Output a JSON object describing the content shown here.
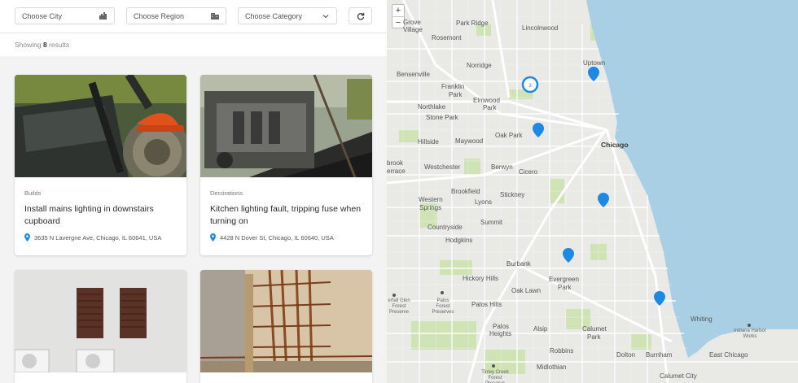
{
  "filters": {
    "city": "Choose City",
    "region": "Choose Region",
    "category": "Choose Category"
  },
  "results": {
    "prefix": "Showing",
    "count": "8",
    "suffix": "results"
  },
  "cards": [
    {
      "category": "Builds",
      "title": "Install mains lighting in downstairs cupboard",
      "address": "3635 N Lavergne Ave, Chicago, IL 60641, USA"
    },
    {
      "category": "Decorations",
      "title": "Kitchen lighting fault, tripping fuse when turning on",
      "address": "4428 N Dover St, Chicago, IL 60640, USA"
    },
    {
      "category": "",
      "title": "",
      "address": ""
    },
    {
      "category": "",
      "title": "",
      "address": ""
    }
  ],
  "map": {
    "zoom_in": "+",
    "zoom_out": "−",
    "cluster_count": "3",
    "labels": [
      "Grove",
      "Village",
      "Park Ridge",
      "Lincolnwood",
      "Rosemont",
      "Norridge",
      "Uptown",
      "Bensenville",
      "Franklin",
      "Park",
      "Elmwood",
      "Park",
      "Northlake",
      "Stone Park",
      "Oak Park",
      "Chicago",
      "Hillside",
      "Maywood",
      "brook",
      "errace",
      "Westchester",
      "Berwyn",
      "Cicero",
      "Brookfield",
      "Lyons",
      "Stickney",
      "Western",
      "Springs",
      "Countryside",
      "Summit",
      "Hodgkins",
      "Burbank",
      "Hickory Hills",
      "Evergreen",
      "Park",
      "Oak Lawn",
      "Palos Hills",
      "Palos",
      "Heights",
      "Alsip",
      "Calumet",
      "Park",
      "Whiting",
      "Robbins",
      "Dolton",
      "Burnham",
      "East Chicago",
      "Midlothian",
      "Calumet City"
    ],
    "poi_labels": [
      "Palos Forest Preserves",
      "erfall Glen Forest Preserve",
      "Indiana Harbor Works",
      "Tinley Creek Forest Preserve"
    ]
  },
  "colors": {
    "accent": "#1e88e5",
    "water": "#a8cfe3",
    "land": "#e8e8e5"
  }
}
